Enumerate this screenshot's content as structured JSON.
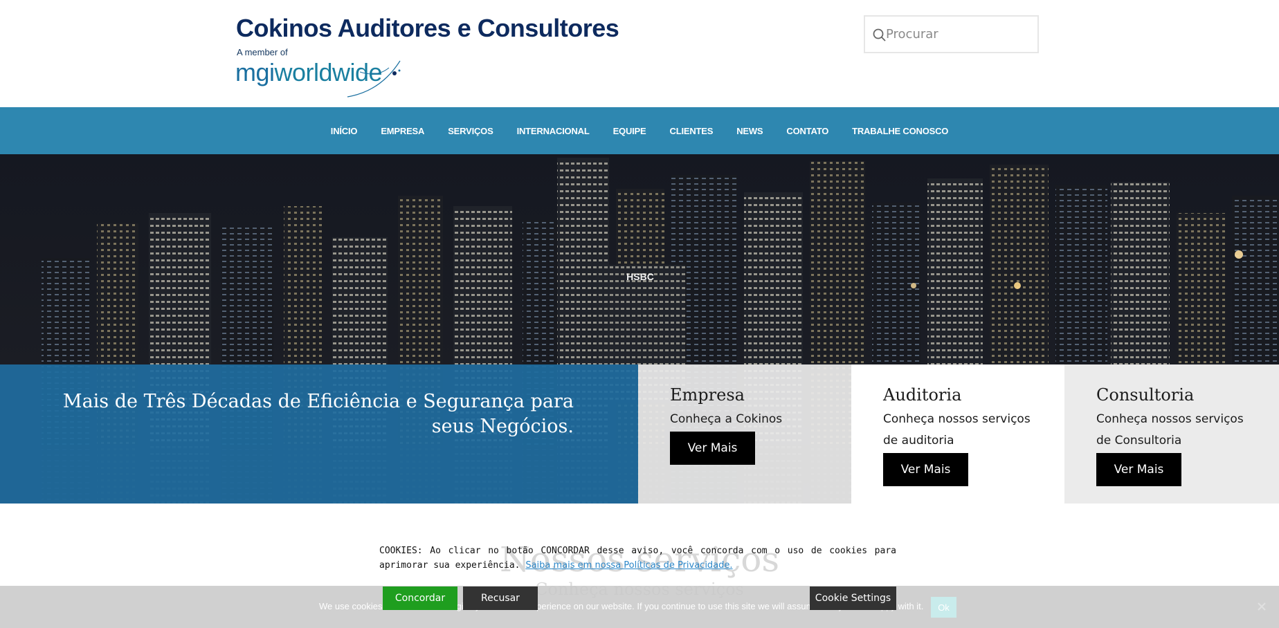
{
  "header": {
    "site_title": "Cokinos Auditores e Consultores",
    "member_of": "A member of",
    "logo_mgi": "mgi",
    "logo_worldwide": "worldwide",
    "search_placeholder": "Procurar"
  },
  "nav": {
    "items": [
      "INÍCIO",
      "EMPRESA",
      "SERVIÇOS",
      "INTERNACIONAL",
      "EQUIPE",
      "CLIENTES",
      "NEWS",
      "CONTATO",
      "TRABALHE CONOSCO"
    ]
  },
  "hero": {
    "headline": "Mais de Três Décadas de Eficiência e Segurança para seus Negócios.",
    "sign_text": "HSBC",
    "cards": [
      {
        "title": "Empresa",
        "text": "Conheça a Cokinos",
        "button": "Ver Mais"
      },
      {
        "title": "Auditoria",
        "text": "Conheça nossos serviços de auditoria",
        "button": "Ver Mais"
      },
      {
        "title": "Consultoria",
        "text": "Conheça nossos serviços de Consultoria",
        "button": "Ver Mais"
      }
    ]
  },
  "section": {
    "title": "Nossos serviços",
    "subtitle": "Conheça nossos serviços"
  },
  "cookie_notice": {
    "text": "COOKIES: Ao clicar no botão CONCORDAR desse aviso, você concorda com o uso de cookies para aprimorar sua experiência.",
    "link": "Saiba mais em nossa Políticas de Privacidade.",
    "agree": "Concordar",
    "refuse": "Recusar",
    "settings": "Cookie Settings"
  },
  "cookie_bar": {
    "message": "We use cookies to ensure that we give you the best experience on our website. If you continue to use this site we will assume that you are happy with it.",
    "ok": "Ok"
  },
  "colors": {
    "nav_bg": "#2e87b0",
    "title_navy": "#0d2a5e",
    "hero_overlay": "#206ca0",
    "agree_green": "#1f9e1f"
  }
}
